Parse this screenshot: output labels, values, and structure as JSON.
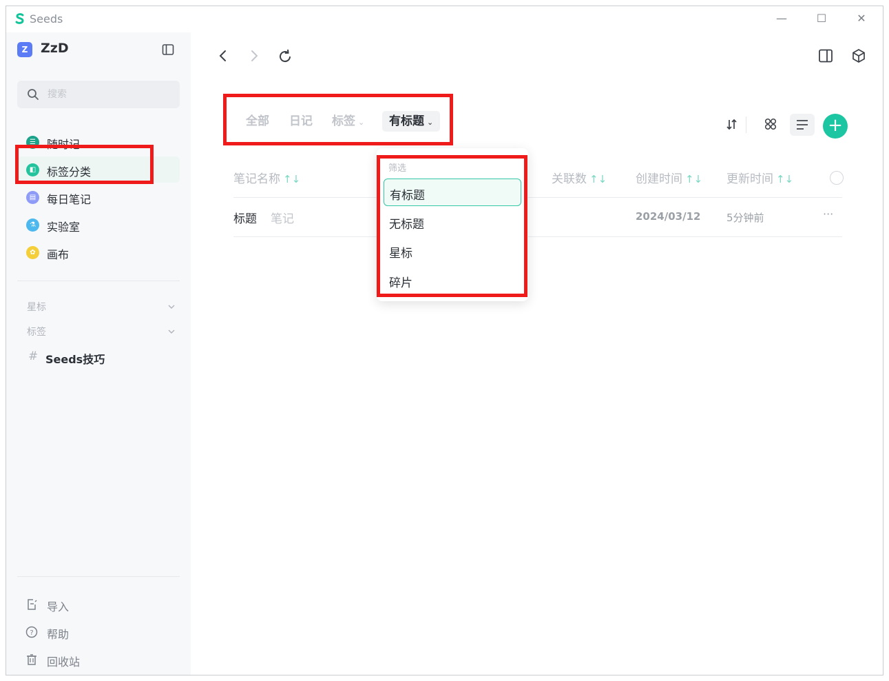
{
  "window": {
    "app_title": "Seeds",
    "controls": {
      "minimize": "—",
      "maximize": "☐",
      "close": "✕"
    }
  },
  "sidebar": {
    "workspace_badge": "Z",
    "workspace_name": "ZzD",
    "search": {
      "placeholder": "搜索",
      "value": ""
    },
    "nav_items": [
      {
        "label": "随时记",
        "icon": "list-icon",
        "color": "#1aa38a"
      },
      {
        "label": "标签分类",
        "icon": "tag-folder-icon",
        "color": "#22c39d",
        "active": true
      },
      {
        "label": "每日笔记",
        "icon": "calendar-note-icon",
        "color": "#8e9cf7"
      },
      {
        "label": "实验室",
        "icon": "lab-icon",
        "color": "#4cb8ee"
      },
      {
        "label": "画布",
        "icon": "canvas-icon",
        "color": "#f5cf3a"
      }
    ],
    "sections": [
      {
        "label": "星标"
      },
      {
        "label": "标签"
      }
    ],
    "tags": [
      {
        "hash": "#",
        "label": "Seeds技巧"
      }
    ],
    "footer": [
      {
        "label": "导入",
        "icon": "import-icon"
      },
      {
        "label": "帮助",
        "icon": "help-icon"
      },
      {
        "label": "回收站",
        "icon": "trash-icon"
      }
    ]
  },
  "main": {
    "tabs": [
      {
        "label": "全部"
      },
      {
        "label": "日记"
      },
      {
        "label": "标签",
        "has_chevron": true
      },
      {
        "label": "有标题",
        "has_chevron": true,
        "selected": true
      }
    ],
    "chevron": "⌄",
    "add_label": "+",
    "columns": [
      {
        "label": "笔记名称",
        "sort": "↑↓"
      },
      {
        "label": "关联数",
        "sort": "↑↓"
      },
      {
        "label": "创建时间",
        "sort": "↑↓"
      },
      {
        "label": "更新时间",
        "sort": "↑↓"
      }
    ],
    "rows": [
      {
        "title": "标题",
        "type": "笔记",
        "created": "2024/03/12",
        "updated": "5分钟前",
        "more": "···"
      }
    ]
  },
  "dropdown": {
    "caption": "筛选",
    "options": [
      {
        "label": "有标题",
        "selected": true
      },
      {
        "label": "无标题"
      },
      {
        "label": "星标"
      },
      {
        "label": "碎片"
      }
    ]
  },
  "colors": {
    "accent": "#1cc6a2",
    "highlight": "#ef1b1b",
    "active_nav_bg": "#eef6f4"
  }
}
